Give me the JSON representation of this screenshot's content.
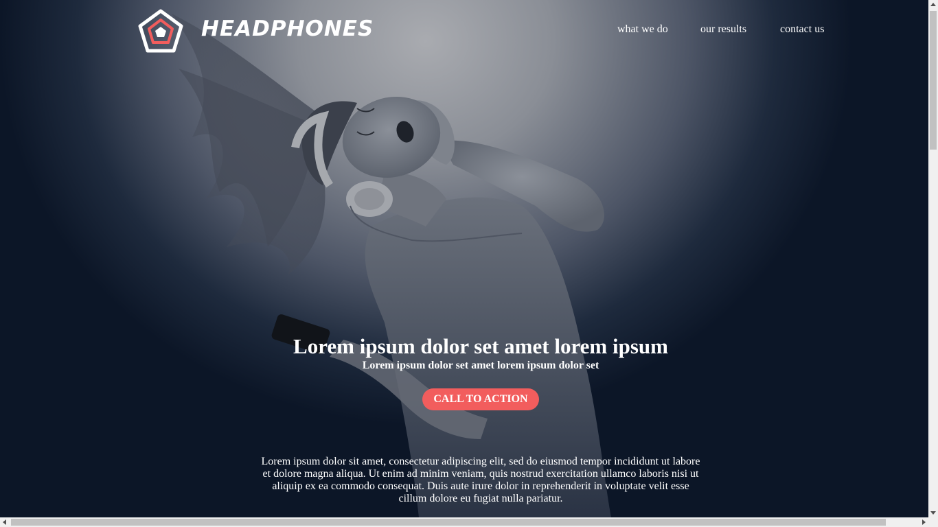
{
  "brand": {
    "name": "HEADPHONES",
    "logo_outer_color": "#ffffff",
    "logo_inner_color": "#f25d5d",
    "accent_color": "#f25d5d",
    "logo_icon": "pentagon-logo-icon"
  },
  "nav": {
    "items": [
      {
        "label": "what we do"
      },
      {
        "label": "our results"
      },
      {
        "label": "contact us"
      }
    ]
  },
  "hero": {
    "title": "Lorem ipsum dolor set amet lorem ipsum",
    "subtitle": "Lorem ipsum dolor set amet lorem ipsum dolor set",
    "cta_label": "CALL TO ACTION",
    "body": "Lorem ipsum dolor sit amet, consectetur adipiscing elit, sed do eiusmod tempor incididunt ut labore et dolore magna aliqua. Ut enim ad minim veniam, quis nostrud exercitation ullamco laboris nisi ut aliquip ex ea commodo consequat. Duis aute irure dolor in reprehenderit in voluptate velit esse cillum dolore eu fugiat nulla pariatur."
  },
  "scrollbars": {
    "vertical_icons": [
      "scroll-up-arrow-icon",
      "scroll-down-arrow-icon"
    ],
    "horizontal_icons": [
      "scroll-left-arrow-icon",
      "scroll-right-arrow-icon"
    ]
  }
}
